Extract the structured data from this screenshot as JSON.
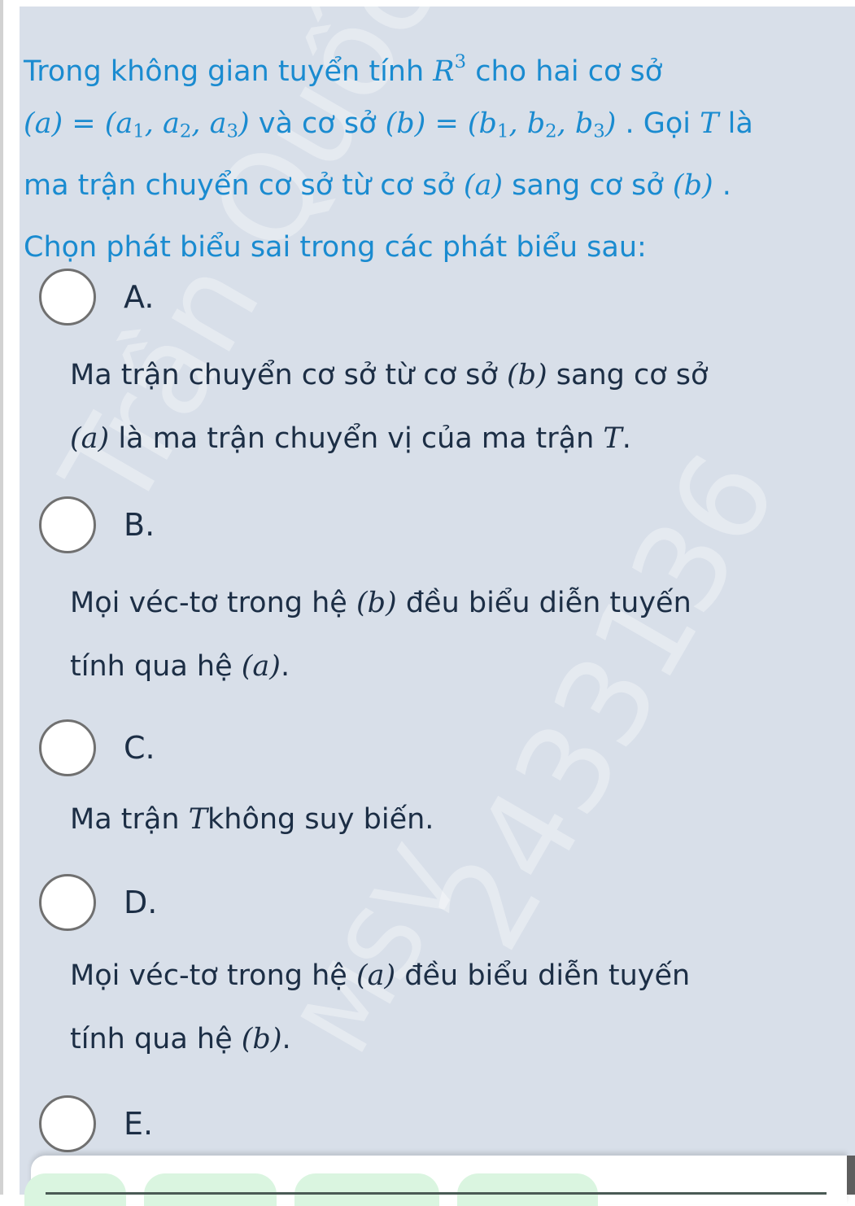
{
  "question": {
    "line1": {
      "pre": "Trong  không  gian  tuyển  tính ",
      "math_base": "R",
      "math_sup": "3",
      "post": " cho  hai  cơ  sở"
    },
    "line2": {
      "basis_a": "(a) = (a",
      "sub1": "1",
      "sep1": ", a",
      "sub2": "2",
      "sep2": ", a",
      "sub3": "3",
      "close": ")",
      "mid": " và cơ sở ",
      "basis_b": "(b) = (b",
      "bsub1": "1",
      "bsep1": ", b",
      "bsub2": "2",
      "bsep2": ", b",
      "bsub3": "3",
      "bclose": ")",
      "post": " . Gọi ",
      "T": "T",
      "end": " là"
    },
    "line3": {
      "pre": "ma trận chuyển cơ sở từ cơ sở ",
      "a": "(a)",
      "mid": " sang cơ sở ",
      "b": "(b)",
      "end": " ."
    },
    "line4": "Chọn phát biểu sai trong các phát biểu sau:"
  },
  "options": [
    {
      "letter": "A.",
      "line1": {
        "pre": "Ma trận chuyển cơ sở từ cơ sở ",
        "m": "(b)",
        "post": " sang cơ sở"
      },
      "line2": {
        "pre": "",
        "m": "(a)",
        "post": " là ma trận chuyển vị của ma trận ",
        "m2": "T",
        "end": "."
      }
    },
    {
      "letter": "B.",
      "line1": {
        "pre": "Mọi véc-tơ trong hệ ",
        "m": "(b)",
        "post": " đều biểu diễn tuyến"
      },
      "line2": {
        "pre": "tính qua hệ ",
        "m": "(a)",
        "post": "."
      }
    },
    {
      "letter": "C.",
      "line1": {
        "pre": "Ma trận ",
        "m": "T",
        "post": "không suy biến."
      }
    },
    {
      "letter": "D.",
      "line1": {
        "pre": "Mọi véc-tơ trong hệ ",
        "m": "(a)",
        "post": " đều biểu diễn tuyến"
      },
      "line2": {
        "pre": "tính qua hệ ",
        "m": "(b)",
        "post": "."
      }
    },
    {
      "letter": "E."
    }
  ],
  "watermark": [
    "Trần Quốc",
    "2433136",
    "MSV"
  ],
  "colors": {
    "question": "#1a8bd0",
    "option_text": "#1c2e45",
    "card_bg": "#d8dfe9",
    "tab_green": "#daf5e0"
  }
}
